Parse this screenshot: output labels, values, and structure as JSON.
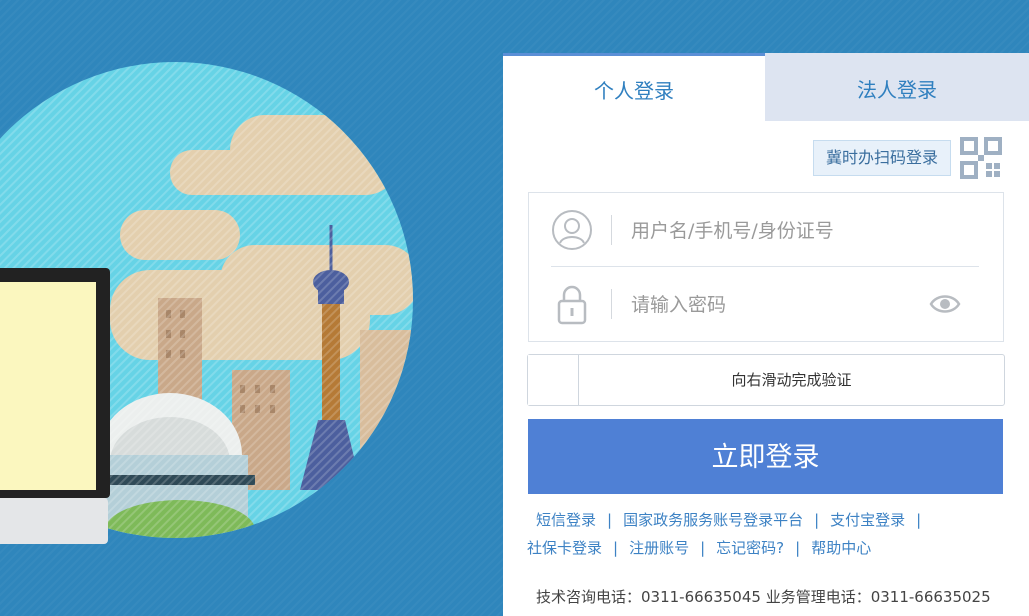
{
  "tabs": {
    "personal": "个人登录",
    "corporate": "法人登录"
  },
  "qr": {
    "label": "冀时办扫码登录",
    "icon": "qr-code-icon"
  },
  "form": {
    "username_placeholder": "用户名/手机号/身份证号",
    "username_value": "",
    "password_placeholder": "请输入密码",
    "password_value": "",
    "icons": {
      "user": "user-icon",
      "lock": "lock-icon",
      "visibility": "eye-icon"
    }
  },
  "slider": {
    "text": "向右滑动完成验证"
  },
  "login_button": "立即登录",
  "links": {
    "line1": [
      "短信登录",
      "国家政务服务账号登录平台",
      "支付宝登录"
    ],
    "line2": [
      "社保卡登录",
      "注册账号",
      "忘记密码?",
      "帮助中心"
    ]
  },
  "hotline": "技术咨询电话：0311-66635045 业务管理电话：0311-66635025",
  "colors": {
    "background": "#2f86bc",
    "accent": "#4f80d5",
    "link": "#3d82c4",
    "inactive_tab": "#dde4f1"
  }
}
